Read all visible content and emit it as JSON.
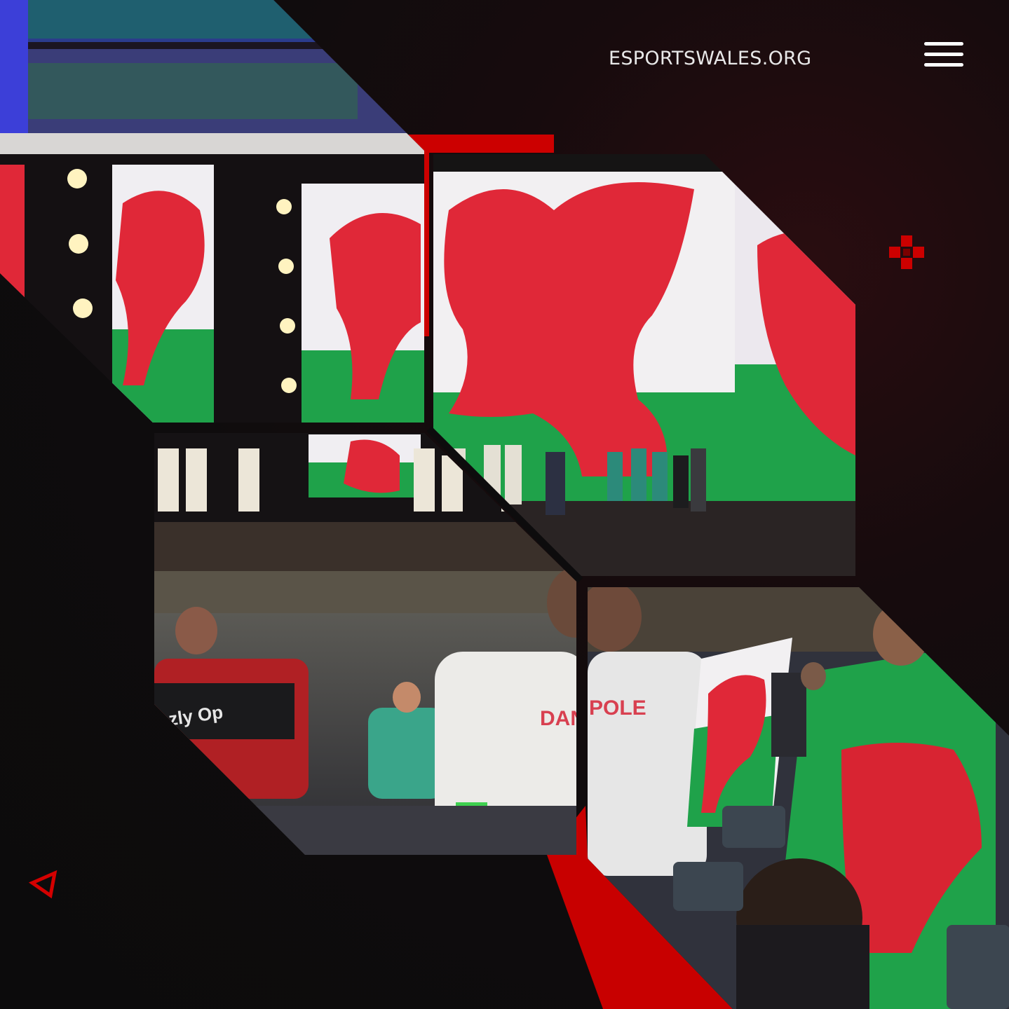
{
  "header": {
    "site_name": "ESPORTSWALES.ORG",
    "menu_icon": "hamburger-menu-icon"
  },
  "decorations": {
    "cross_icon": "pixel-cross-icon",
    "triangle_icon": "triangle-outline-icon"
  },
  "photos": {
    "shirt_name": "DANPOLE",
    "shirt_name_left": "zly Op"
  },
  "colors": {
    "background": "#0d0c0d",
    "accent_red": "#cc0000",
    "flag_red": "#e02838",
    "flag_green": "#1fa24a",
    "flag_white": "#f4f4f4"
  }
}
